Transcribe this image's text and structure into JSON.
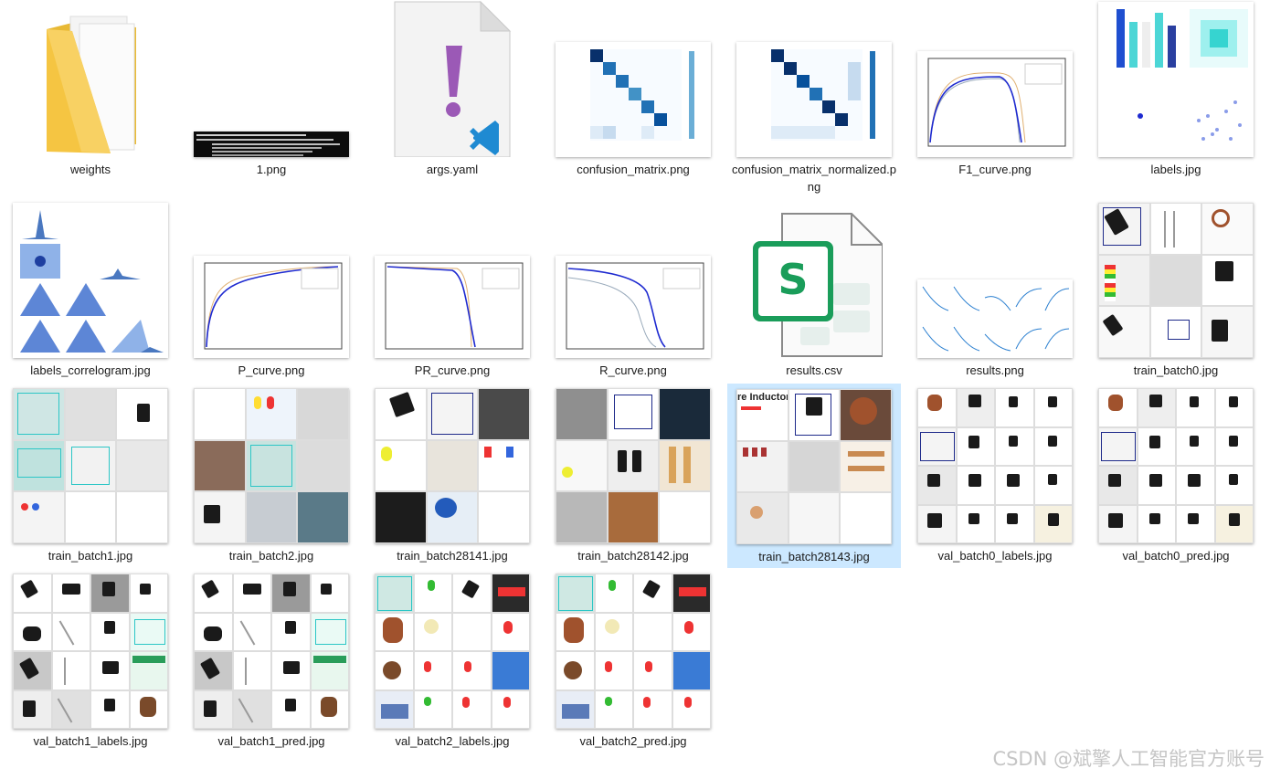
{
  "files": [
    {
      "name": "weights",
      "kind": "folder"
    },
    {
      "name": "1.png",
      "kind": "terminal-image"
    },
    {
      "name": "args.yaml",
      "kind": "yaml-file"
    },
    {
      "name": "confusion_matrix.png",
      "kind": "heatmap-image"
    },
    {
      "name": "confusion_matrix_normalized.png",
      "kind": "heatmap-image"
    },
    {
      "name": "F1_curve.png",
      "kind": "curve-image"
    },
    {
      "name": "labels.jpg",
      "kind": "labels-image"
    },
    {
      "name": "labels_correlogram.jpg",
      "kind": "correlogram-image"
    },
    {
      "name": "P_curve.png",
      "kind": "curve-image"
    },
    {
      "name": "PR_curve.png",
      "kind": "curve-image"
    },
    {
      "name": "R_curve.png",
      "kind": "curve-image"
    },
    {
      "name": "results.csv",
      "kind": "csv-file"
    },
    {
      "name": "results.png",
      "kind": "results-image"
    },
    {
      "name": "train_batch0.jpg",
      "kind": "mosaic-image"
    },
    {
      "name": "train_batch1.jpg",
      "kind": "mosaic-image"
    },
    {
      "name": "train_batch2.jpg",
      "kind": "mosaic-image"
    },
    {
      "name": "train_batch28141.jpg",
      "kind": "mosaic-image"
    },
    {
      "name": "train_batch28142.jpg",
      "kind": "mosaic-image"
    },
    {
      "name": "train_batch28143.jpg",
      "kind": "mosaic-image",
      "selected": true
    },
    {
      "name": "val_batch0_labels.jpg",
      "kind": "mosaic-image"
    },
    {
      "name": "val_batch0_pred.jpg",
      "kind": "mosaic-image"
    },
    {
      "name": "val_batch1_labels.jpg",
      "kind": "mosaic-image"
    },
    {
      "name": "val_batch1_pred.jpg",
      "kind": "mosaic-image"
    },
    {
      "name": "val_batch2_labels.jpg",
      "kind": "mosaic-image"
    },
    {
      "name": "val_batch2_pred.jpg",
      "kind": "mosaic-image"
    }
  ],
  "thumb_text": {
    "inductor_banner": "re Inductor"
  },
  "watermark": "CSDN @斌擎人工智能官方账号",
  "colors": {
    "selection": "#cce8ff",
    "folder": "#f5c542",
    "yaml_mark": "#9b59b6",
    "vscode_blue": "#1f8ad2",
    "csv_green": "#1a9d5a",
    "box_blue": "#1e2a8a",
    "box_cyan": "#2cc6c6"
  }
}
